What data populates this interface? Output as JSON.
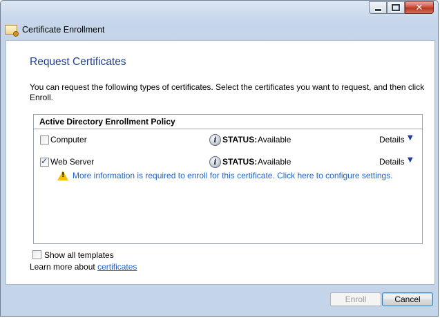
{
  "window": {
    "title": "Certificate Enrollment",
    "caption_buttons": {
      "minimize_icon": "minimize-icon",
      "maximize_icon": "maximize-icon",
      "close_icon": "close-icon",
      "close_glyph": "✕"
    }
  },
  "page": {
    "title": "Request Certificates",
    "intro": "You can request the following types of certificates. Select the certificates you want to request, and then click Enroll."
  },
  "policy": {
    "name": "Active Directory Enrollment Policy",
    "certificates": [
      {
        "name": "Computer",
        "checked": false,
        "status_label": "STATUS:",
        "status_value": "Available",
        "details_label": "Details"
      },
      {
        "name": "Web Server",
        "checked": true,
        "status_label": "STATUS:",
        "status_value": "Available",
        "details_label": "Details"
      }
    ],
    "warning": "More information is required to enroll for this certificate. Click here to configure settings."
  },
  "options": {
    "show_all_label": "Show all templates",
    "learn_more_prefix": "Learn more about ",
    "learn_more_link": "certificates"
  },
  "buttons": {
    "enroll_label": "Enroll",
    "cancel_label": "Cancel"
  },
  "colors": {
    "title_blue": "#1e3f95",
    "link_blue": "#1e61c9",
    "warning_yellow": "#f2c200"
  }
}
